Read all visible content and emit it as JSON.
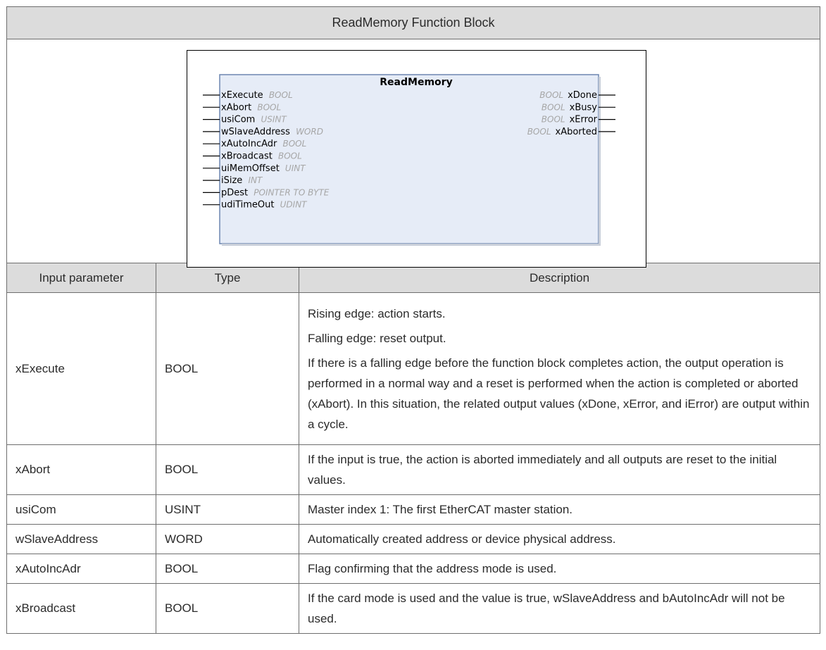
{
  "table_title": "ReadMemory Function Block",
  "figure": {
    "block_name": "ReadMemory",
    "inputs": [
      {
        "name": "xExecute",
        "type": "BOOL"
      },
      {
        "name": "xAbort",
        "type": "BOOL"
      },
      {
        "name": "usiCom",
        "type": "USINT"
      },
      {
        "name": "wSlaveAddress",
        "type": "WORD"
      },
      {
        "name": "xAutoIncAdr",
        "type": "BOOL"
      },
      {
        "name": "xBroadcast",
        "type": "BOOL"
      },
      {
        "name": "uiMemOffset",
        "type": "UINT"
      },
      {
        "name": "iSize",
        "type": "INT"
      },
      {
        "name": "pDest",
        "type": "POINTER TO BYTE"
      },
      {
        "name": "udiTimeOut",
        "type": "UDINT"
      }
    ],
    "outputs": [
      {
        "name": "xDone",
        "type": "BOOL"
      },
      {
        "name": "xBusy",
        "type": "BOOL"
      },
      {
        "name": "xError",
        "type": "BOOL"
      },
      {
        "name": "xAborted",
        "type": "BOOL"
      }
    ]
  },
  "headers": {
    "param": "Input parameter",
    "type": "Type",
    "desc": "Description"
  },
  "rows": [
    {
      "param": "xExecute",
      "type": "BOOL",
      "desc": [
        "Rising edge: action starts.",
        "Falling edge: reset output.",
        "If there is a falling edge before the function block completes action, the output operation is performed in a normal way and a reset is performed when the action is completed or aborted (xAbort). In this situation, the related output values (xDone, xError, and iError) are output within a cycle."
      ]
    },
    {
      "param": "xAbort",
      "type": "BOOL",
      "desc": [
        "If the input is true, the action is aborted immediately and all outputs are reset to the initial values."
      ]
    },
    {
      "param": "usiCom",
      "type": "USINT",
      "desc": [
        "Master index 1: The first EtherCAT master station."
      ]
    },
    {
      "param": "wSlaveAddress",
      "type": "WORD",
      "desc": [
        "Automatically created address or device physical address."
      ]
    },
    {
      "param": "xAutoIncAdr",
      "type": "BOOL",
      "desc": [
        "Flag confirming that the address mode is used."
      ]
    },
    {
      "param": "xBroadcast",
      "type": "BOOL",
      "desc": [
        "If the card mode is used and the value is true, wSlaveAddress and bAutoIncAdr will not be used."
      ]
    }
  ],
  "colors": {
    "header_bg": "#dcdcdc",
    "block_fill": "#e6ecf7",
    "block_border": "#6d86b0"
  }
}
